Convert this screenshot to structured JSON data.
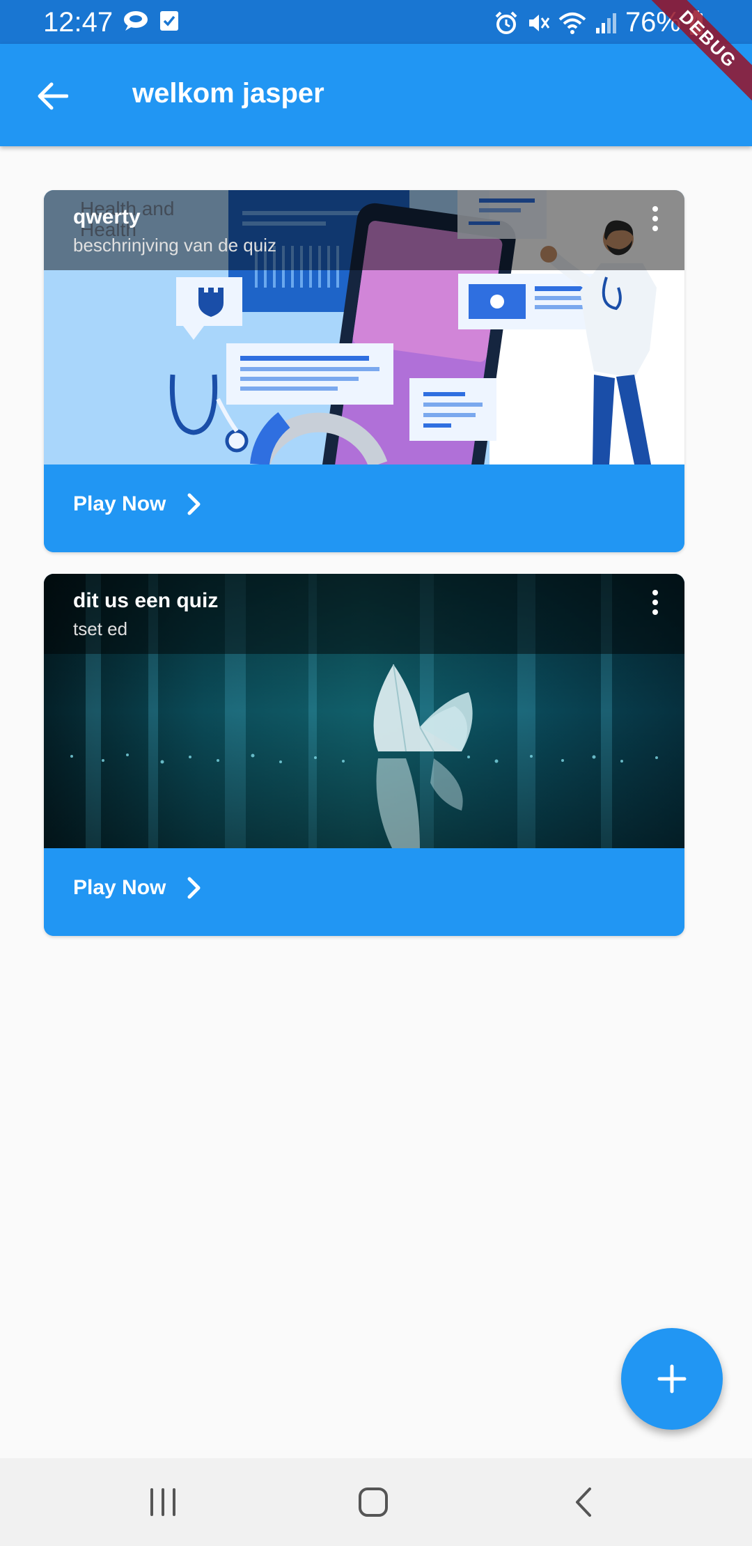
{
  "status_bar": {
    "time": "12:47",
    "battery_percent": "76%",
    "icons": [
      "chat-bubble-icon",
      "checkbox-icon",
      "alarm-icon",
      "mute-icon",
      "wifi-icon",
      "signal-icon",
      "battery-charging-icon"
    ]
  },
  "debug_banner": "DEBUG",
  "app_bar": {
    "title": "welkom jasper",
    "back_icon": "arrow-back-icon"
  },
  "quizzes": [
    {
      "title": "qwerty",
      "description": "beschrinjving van de quiz",
      "image_label": "Health and Health",
      "play_label": "Play Now"
    },
    {
      "title": "dit us een quiz",
      "description": "tset ed",
      "play_label": "Play Now"
    }
  ],
  "fab_icon": "plus-icon",
  "nav_bar": {
    "icons": [
      "recent-apps-icon",
      "home-icon",
      "back-icon"
    ]
  },
  "colors": {
    "primary": "#2196f3",
    "status_bar": "#1976d2",
    "background": "#fafafa"
  }
}
